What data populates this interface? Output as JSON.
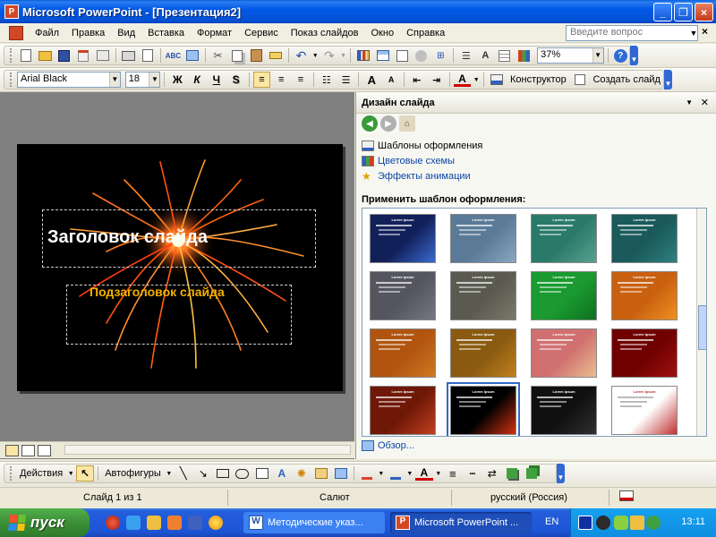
{
  "window": {
    "title": "Microsoft PowerPoint - [Презентация2]",
    "min_glyph": "_",
    "restore_glyph": "❐",
    "close_glyph": "×"
  },
  "menu": {
    "items": [
      "Файл",
      "Правка",
      "Вид",
      "Вставка",
      "Формат",
      "Сервис",
      "Показ слайдов",
      "Окно",
      "Справка"
    ],
    "help_placeholder": "Введите вопрос",
    "close_doc_glyph": "×"
  },
  "standard_toolbar": {
    "zoom": "37%"
  },
  "format_toolbar": {
    "font": "Arial Black",
    "size": "18",
    "bold": "Ж",
    "italic": "К",
    "underline": "Ч",
    "shadow": "S",
    "grow_font": "A",
    "shrink_font": "A",
    "font_color": "A",
    "designer": "Конструктор",
    "new_slide": "Создать слайд"
  },
  "slide": {
    "title": "Заголовок слайда",
    "subtitle": "Подзаголовок слайда",
    "title_color": "#ffffff",
    "subtitle_color": "#f4b000"
  },
  "task_pane": {
    "header": "Дизайн слайда",
    "links": [
      "Шаблоны оформления",
      "Цветовые схемы",
      "Эффекты анимации"
    ],
    "apply_label": "Применить шаблон оформления:",
    "browse": "Обзор...",
    "thumb_title": "Lorem Ipsum",
    "templates": [
      {
        "bg": "#12205a",
        "accent": "#3a6ad0"
      },
      {
        "bg": "#5a7a98",
        "accent": "#8aa7c0"
      },
      {
        "bg": "#2a7a6a",
        "accent": "#5aa08f"
      },
      {
        "bg": "#1a5a5a",
        "accent": "#2f8080"
      },
      {
        "bg": "#555560",
        "accent": "#777785"
      },
      {
        "bg": "#5a5a50",
        "accent": "#7a7a6a"
      },
      {
        "bg": "#1a9a30",
        "accent": "#0e7020"
      },
      {
        "bg": "#c86010",
        "accent": "#f09020"
      },
      {
        "bg": "#b05410",
        "accent": "#d07820"
      },
      {
        "bg": "#8a5a10",
        "accent": "#c08020"
      },
      {
        "bg": "#d07070",
        "accent": "#e8c090"
      },
      {
        "bg": "#700000",
        "accent": "#a01010"
      },
      {
        "bg": "#701808",
        "accent": "#c04020"
      },
      {
        "bg": "#000000",
        "accent": "#d03010"
      },
      {
        "bg": "#101010",
        "accent": "#303030"
      },
      {
        "bg": "#ffffff",
        "accent": "#c03030"
      }
    ]
  },
  "drawing_toolbar": {
    "actions": "Действия",
    "autoshapes": "Автофигуры"
  },
  "status": {
    "slide": "Слайд 1 из 1",
    "design": "Салют",
    "language": "русский (Россия)"
  },
  "taskbar": {
    "start": "пуск",
    "buttons": [
      "Методические указ...",
      "Microsoft PowerPoint ..."
    ],
    "lang": "EN",
    "clock": "13:11"
  },
  "colors": {
    "titlebar": "#0058e6",
    "taskbar": "#245edb",
    "start": "#3c8f37"
  }
}
